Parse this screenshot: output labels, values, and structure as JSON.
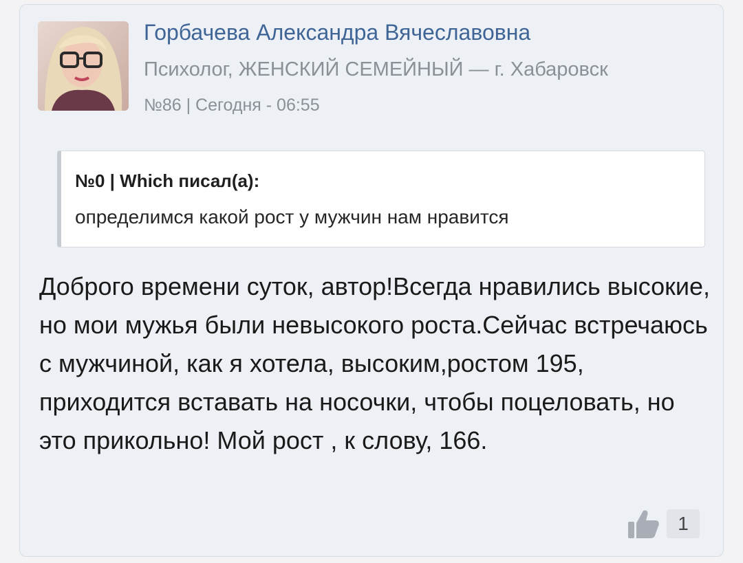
{
  "post": {
    "author_name": "Горбачева Александра Вячеславовна",
    "author_description": "Психолог, ЖЕНСКИЙ СЕМЕЙНЫЙ — г. Хабаровск",
    "meta": "№86 | Сегодня - 06:55",
    "quote": {
      "header": "№0 | Which писал(а):",
      "text": "определимся какой рост у мужчин нам нравится"
    },
    "body": "Доброго времени суток, автор!Всегда нравились высокие, но мои мужья были невысокого роста.Сейчас встречаюсь с мужчиной, как я хотела, высоким,ростом 195, приходится вставать на носочки, чтобы поцеловать, но это прикольно! Мой рост , к слову, 166.",
    "likes": "1",
    "like_icon": "thumbs-up-icon",
    "avatar_icon": "author-avatar"
  },
  "colors": {
    "author_name": "#3f6596",
    "meta_text": "#8b8f96",
    "card_bg": "#edf0f5"
  }
}
